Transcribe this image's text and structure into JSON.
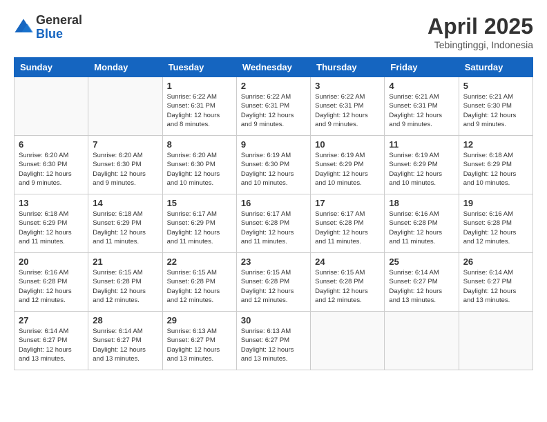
{
  "header": {
    "logo": {
      "general": "General",
      "blue": "Blue"
    },
    "title": "April 2025",
    "subtitle": "Tebingtinggi, Indonesia"
  },
  "days_of_week": [
    "Sunday",
    "Monday",
    "Tuesday",
    "Wednesday",
    "Thursday",
    "Friday",
    "Saturday"
  ],
  "weeks": [
    [
      {
        "day": "",
        "info": ""
      },
      {
        "day": "",
        "info": ""
      },
      {
        "day": "1",
        "info": "Sunrise: 6:22 AM\nSunset: 6:31 PM\nDaylight: 12 hours and 8 minutes."
      },
      {
        "day": "2",
        "info": "Sunrise: 6:22 AM\nSunset: 6:31 PM\nDaylight: 12 hours and 9 minutes."
      },
      {
        "day": "3",
        "info": "Sunrise: 6:22 AM\nSunset: 6:31 PM\nDaylight: 12 hours and 9 minutes."
      },
      {
        "day": "4",
        "info": "Sunrise: 6:21 AM\nSunset: 6:31 PM\nDaylight: 12 hours and 9 minutes."
      },
      {
        "day": "5",
        "info": "Sunrise: 6:21 AM\nSunset: 6:30 PM\nDaylight: 12 hours and 9 minutes."
      }
    ],
    [
      {
        "day": "6",
        "info": "Sunrise: 6:20 AM\nSunset: 6:30 PM\nDaylight: 12 hours and 9 minutes."
      },
      {
        "day": "7",
        "info": "Sunrise: 6:20 AM\nSunset: 6:30 PM\nDaylight: 12 hours and 9 minutes."
      },
      {
        "day": "8",
        "info": "Sunrise: 6:20 AM\nSunset: 6:30 PM\nDaylight: 12 hours and 10 minutes."
      },
      {
        "day": "9",
        "info": "Sunrise: 6:19 AM\nSunset: 6:30 PM\nDaylight: 12 hours and 10 minutes."
      },
      {
        "day": "10",
        "info": "Sunrise: 6:19 AM\nSunset: 6:29 PM\nDaylight: 12 hours and 10 minutes."
      },
      {
        "day": "11",
        "info": "Sunrise: 6:19 AM\nSunset: 6:29 PM\nDaylight: 12 hours and 10 minutes."
      },
      {
        "day": "12",
        "info": "Sunrise: 6:18 AM\nSunset: 6:29 PM\nDaylight: 12 hours and 10 minutes."
      }
    ],
    [
      {
        "day": "13",
        "info": "Sunrise: 6:18 AM\nSunset: 6:29 PM\nDaylight: 12 hours and 11 minutes."
      },
      {
        "day": "14",
        "info": "Sunrise: 6:18 AM\nSunset: 6:29 PM\nDaylight: 12 hours and 11 minutes."
      },
      {
        "day": "15",
        "info": "Sunrise: 6:17 AM\nSunset: 6:29 PM\nDaylight: 12 hours and 11 minutes."
      },
      {
        "day": "16",
        "info": "Sunrise: 6:17 AM\nSunset: 6:28 PM\nDaylight: 12 hours and 11 minutes."
      },
      {
        "day": "17",
        "info": "Sunrise: 6:17 AM\nSunset: 6:28 PM\nDaylight: 12 hours and 11 minutes."
      },
      {
        "day": "18",
        "info": "Sunrise: 6:16 AM\nSunset: 6:28 PM\nDaylight: 12 hours and 11 minutes."
      },
      {
        "day": "19",
        "info": "Sunrise: 6:16 AM\nSunset: 6:28 PM\nDaylight: 12 hours and 12 minutes."
      }
    ],
    [
      {
        "day": "20",
        "info": "Sunrise: 6:16 AM\nSunset: 6:28 PM\nDaylight: 12 hours and 12 minutes."
      },
      {
        "day": "21",
        "info": "Sunrise: 6:15 AM\nSunset: 6:28 PM\nDaylight: 12 hours and 12 minutes."
      },
      {
        "day": "22",
        "info": "Sunrise: 6:15 AM\nSunset: 6:28 PM\nDaylight: 12 hours and 12 minutes."
      },
      {
        "day": "23",
        "info": "Sunrise: 6:15 AM\nSunset: 6:28 PM\nDaylight: 12 hours and 12 minutes."
      },
      {
        "day": "24",
        "info": "Sunrise: 6:15 AM\nSunset: 6:28 PM\nDaylight: 12 hours and 12 minutes."
      },
      {
        "day": "25",
        "info": "Sunrise: 6:14 AM\nSunset: 6:27 PM\nDaylight: 12 hours and 13 minutes."
      },
      {
        "day": "26",
        "info": "Sunrise: 6:14 AM\nSunset: 6:27 PM\nDaylight: 12 hours and 13 minutes."
      }
    ],
    [
      {
        "day": "27",
        "info": "Sunrise: 6:14 AM\nSunset: 6:27 PM\nDaylight: 12 hours and 13 minutes."
      },
      {
        "day": "28",
        "info": "Sunrise: 6:14 AM\nSunset: 6:27 PM\nDaylight: 12 hours and 13 minutes."
      },
      {
        "day": "29",
        "info": "Sunrise: 6:13 AM\nSunset: 6:27 PM\nDaylight: 12 hours and 13 minutes."
      },
      {
        "day": "30",
        "info": "Sunrise: 6:13 AM\nSunset: 6:27 PM\nDaylight: 12 hours and 13 minutes."
      },
      {
        "day": "",
        "info": ""
      },
      {
        "day": "",
        "info": ""
      },
      {
        "day": "",
        "info": ""
      }
    ]
  ]
}
